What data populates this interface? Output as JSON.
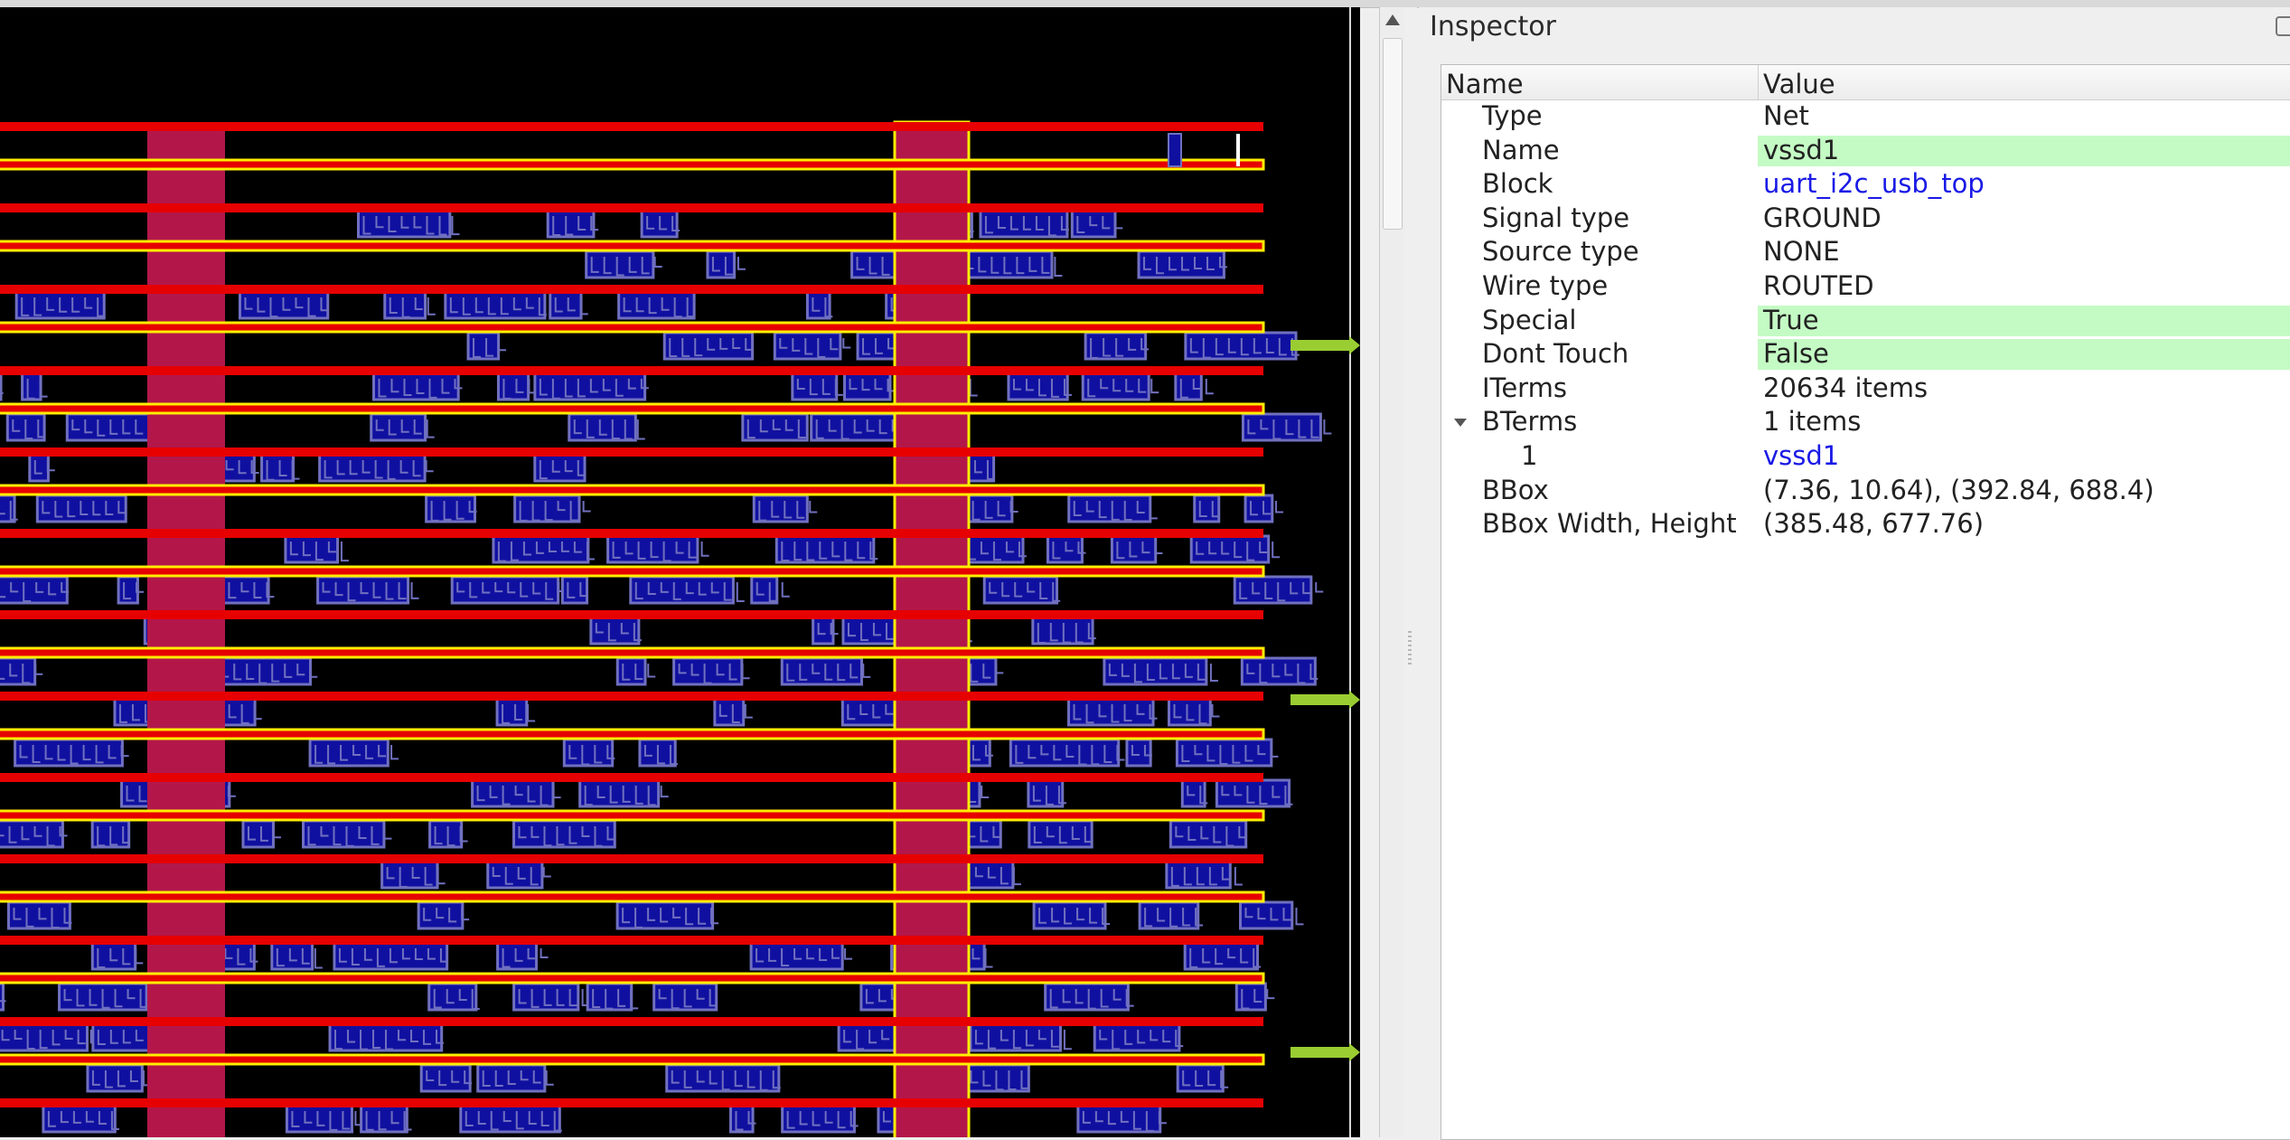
{
  "inspector": {
    "title": "Inspector",
    "columns": {
      "name": "Name",
      "value": "Value"
    },
    "rows": [
      {
        "name": "Type",
        "value": "Net",
        "highlight": false,
        "link": false,
        "indent": 1
      },
      {
        "name": "Name",
        "value": "vssd1",
        "highlight": true,
        "link": false,
        "indent": 1
      },
      {
        "name": "Block",
        "value": "uart_i2c_usb_top",
        "highlight": false,
        "link": true,
        "indent": 1
      },
      {
        "name": "Signal type",
        "value": "GROUND",
        "highlight": false,
        "link": false,
        "indent": 1
      },
      {
        "name": "Source type",
        "value": "NONE",
        "highlight": false,
        "link": false,
        "indent": 1
      },
      {
        "name": "Wire type",
        "value": "ROUTED",
        "highlight": false,
        "link": false,
        "indent": 1
      },
      {
        "name": "Special",
        "value": "True",
        "highlight": true,
        "link": false,
        "indent": 1
      },
      {
        "name": "Dont Touch",
        "value": "False",
        "highlight": true,
        "link": false,
        "indent": 1
      },
      {
        "name": "ITerms",
        "value": "20634 items",
        "highlight": false,
        "link": false,
        "indent": 1
      },
      {
        "name": "BTerms",
        "value": "1 items",
        "highlight": false,
        "link": false,
        "indent": 1,
        "expanded": true
      },
      {
        "name": "1",
        "value": "vssd1",
        "highlight": false,
        "link": true,
        "indent": 2
      },
      {
        "name": "BBox",
        "value": "(7.36, 10.64), (392.84, 688.4)",
        "highlight": false,
        "link": false,
        "indent": 1
      },
      {
        "name": "BBox Width, Height",
        "value": "(385.48, 677.76)",
        "highlight": false,
        "link": false,
        "indent": 1
      }
    ]
  },
  "layout_view": {
    "colors": {
      "background": "#000000",
      "power_rail": "#e60000",
      "highlight_outline": "#ffee00",
      "stripe_fill": "#b3174a",
      "cell_fill": "#1010a0",
      "cell_outline": "#7070c0",
      "pin_marker": "#9acd32"
    }
  }
}
